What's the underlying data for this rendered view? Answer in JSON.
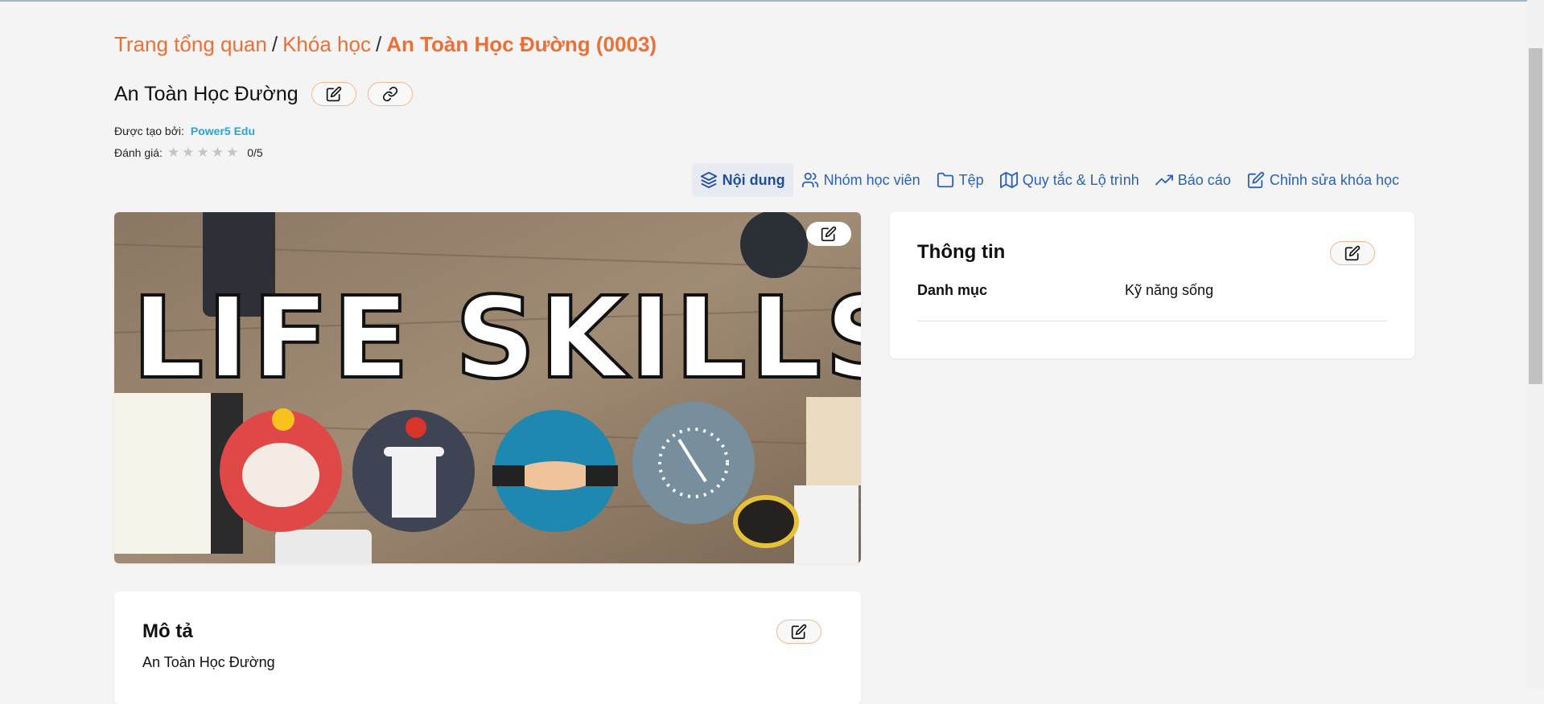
{
  "breadcrumb": {
    "home": "Trang tổng quan",
    "courses": "Khóa học",
    "current": "An Toàn Học Đường (0003)",
    "separator": "/"
  },
  "course": {
    "title": "An Toàn Học Đường",
    "created_by_label": "Được tạo bởi:",
    "created_by": "Power5 Edu",
    "rating_label": "Đánh giá:",
    "rating_value": "0/5",
    "stars_filled": 0,
    "stars_total": 5
  },
  "tabs": [
    {
      "label": "Nội dung",
      "icon": "layers-icon",
      "active": true
    },
    {
      "label": "Nhóm học viên",
      "icon": "users-icon",
      "active": false
    },
    {
      "label": "Tệp",
      "icon": "folder-icon",
      "active": false
    },
    {
      "label": "Quy tắc & Lộ trình",
      "icon": "map-icon",
      "active": false
    },
    {
      "label": "Báo cáo",
      "icon": "trending-up-icon",
      "active": false
    },
    {
      "label": "Chỉnh sửa khóa học",
      "icon": "edit-icon",
      "active": false
    }
  ],
  "cover_image": {
    "text": "LIFE SKILLS"
  },
  "info": {
    "title": "Thông tin",
    "category_label": "Danh mục",
    "category_value": "Kỹ năng sống"
  },
  "description": {
    "title": "Mô tả",
    "text": "An Toàn Học Đường"
  },
  "colors": {
    "accent": "#eb7038",
    "link": "#2b62b8",
    "author": "#21a7d8"
  }
}
